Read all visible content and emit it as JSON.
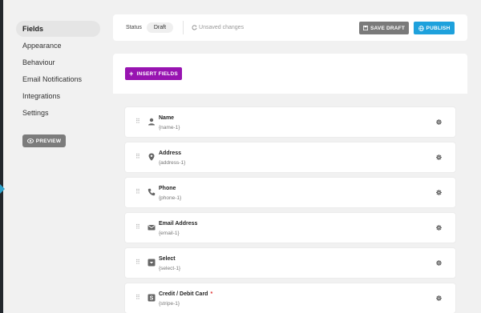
{
  "sidebar": {
    "items": [
      {
        "label": "Fields"
      },
      {
        "label": "Appearance"
      },
      {
        "label": "Behaviour"
      },
      {
        "label": "Email Notifications"
      },
      {
        "label": "Integrations"
      },
      {
        "label": "Settings"
      }
    ],
    "preview_label": "PREVIEW"
  },
  "topbar": {
    "status_label": "Status",
    "status_value": "Draft",
    "unsaved_text": "Unsaved changes",
    "save_draft_label": "SAVE DRAFT",
    "publish_label": "PUBLISH"
  },
  "insert": {
    "label": "INSERT FIELDS"
  },
  "fields": [
    {
      "name": "Name",
      "id": "{name-1}",
      "icon": "user-icon",
      "required": ""
    },
    {
      "name": "Address",
      "id": "{address-1}",
      "icon": "map-pin-icon",
      "required": ""
    },
    {
      "name": "Phone",
      "id": "{phone-1}",
      "icon": "phone-icon",
      "required": ""
    },
    {
      "name": "Email Address",
      "id": "{email-1}",
      "icon": "envelope-icon",
      "required": ""
    },
    {
      "name": "Select",
      "id": "{select-1}",
      "icon": "dropdown-icon",
      "required": ""
    },
    {
      "name": "Credit / Debit Card",
      "id": "{stripe-1}",
      "icon": "stripe-icon",
      "required": "*"
    }
  ],
  "colors": {
    "publish": "#1ea1dc",
    "insert": "#9814b1",
    "save_draft": "#7a7a7a",
    "required": "#e03131"
  }
}
